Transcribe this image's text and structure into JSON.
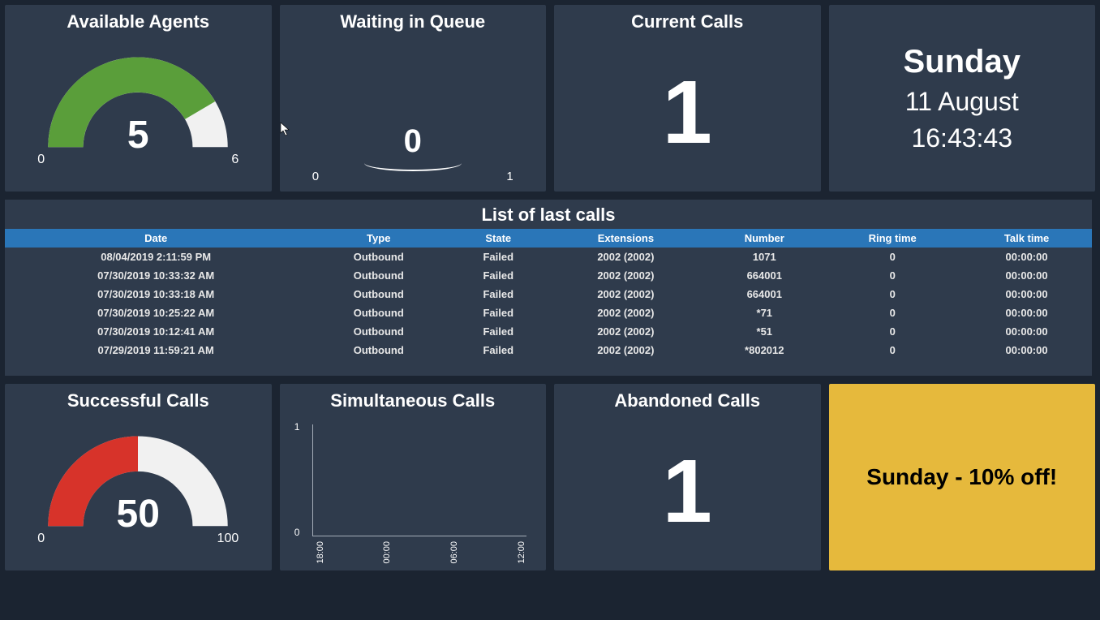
{
  "widgets": {
    "agents": {
      "title": "Available Agents",
      "value": "5",
      "min": "0",
      "max": "6",
      "fill_frac": 0.83,
      "color": "#5a9e3a"
    },
    "queue": {
      "title": "Waiting in Queue",
      "value": "0",
      "min": "0",
      "max": "1"
    },
    "current": {
      "title": "Current Calls",
      "value": "1"
    },
    "clock": {
      "day": "Sunday",
      "date": "11 August",
      "time": "16:43:43"
    },
    "success": {
      "title": "Successful Calls",
      "value": "50",
      "min": "0",
      "max": "100",
      "fill_frac": 0.5,
      "color": "#d7332a"
    },
    "sim": {
      "title": "Simultaneous Calls",
      "ymin": "0",
      "ymax": "1",
      "xticks": [
        "18:00",
        "00:00",
        "06:00",
        "12:00"
      ]
    },
    "abandoned": {
      "title": "Abandoned Calls",
      "value": "1"
    },
    "banner": {
      "text": "Sunday - 10% off!"
    }
  },
  "calls_table": {
    "title": "List of last calls",
    "columns": [
      "Date",
      "Type",
      "State",
      "Extensions",
      "Number",
      "Ring time",
      "Talk time"
    ],
    "rows": [
      [
        "08/04/2019 2:11:59 PM",
        "Outbound",
        "Failed",
        "2002 (2002)",
        "1071",
        "0",
        "00:00:00"
      ],
      [
        "07/30/2019 10:33:32 AM",
        "Outbound",
        "Failed",
        "2002 (2002)",
        "664001",
        "0",
        "00:00:00"
      ],
      [
        "07/30/2019 10:33:18 AM",
        "Outbound",
        "Failed",
        "2002 (2002)",
        "664001",
        "0",
        "00:00:00"
      ],
      [
        "07/30/2019 10:25:22 AM",
        "Outbound",
        "Failed",
        "2002 (2002)",
        "*71",
        "0",
        "00:00:00"
      ],
      [
        "07/30/2019 10:12:41 AM",
        "Outbound",
        "Failed",
        "2002 (2002)",
        "*51",
        "0",
        "00:00:00"
      ],
      [
        "07/29/2019 11:59:21 AM",
        "Outbound",
        "Failed",
        "2002 (2002)",
        "*802012",
        "0",
        "00:00:00"
      ]
    ]
  },
  "chart_data": [
    {
      "type": "gauge",
      "title": "Available Agents",
      "value": 5,
      "min": 0,
      "max": 6,
      "color": "#5a9e3a"
    },
    {
      "type": "gauge",
      "title": "Waiting in Queue",
      "value": 0,
      "min": 0,
      "max": 1
    },
    {
      "type": "gauge",
      "title": "Successful Calls",
      "value": 50,
      "min": 0,
      "max": 100,
      "color": "#d7332a"
    },
    {
      "type": "line",
      "title": "Simultaneous Calls",
      "x": [
        "18:00",
        "00:00",
        "06:00",
        "12:00"
      ],
      "y": [],
      "ylim": [
        0,
        1
      ],
      "xlabel": "",
      "ylabel": ""
    }
  ]
}
